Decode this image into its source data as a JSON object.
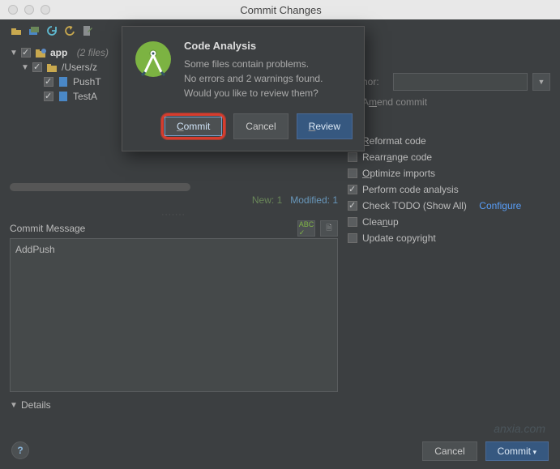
{
  "window": {
    "title": "Commit Changes"
  },
  "tree": {
    "root": {
      "name": "app",
      "suffix": "(2 files)"
    },
    "folder": {
      "path": "/Users/z"
    },
    "files": [
      "PushT",
      "TestA"
    ]
  },
  "stats": {
    "new_label": "New:",
    "new_count": "1",
    "mod_label": "Modified:",
    "mod_count": "1"
  },
  "commit_msg": {
    "label": "Commit Message",
    "value": "AddPush"
  },
  "details": {
    "label": "Details"
  },
  "right": {
    "author_label": "Author:",
    "amend_label": "Amend commit",
    "reformat": "Reformat code",
    "rearrange": "Rearrange code",
    "optimize": "Optimize imports",
    "analysis": "Perform code analysis",
    "todo": "Check TODO (Show All)",
    "configure": "Configure",
    "cleanup": "Cleanup",
    "copyright": "Update copyright"
  },
  "buttons": {
    "cancel": "Cancel",
    "commit": "Commit",
    "help": "?"
  },
  "modal": {
    "title": "Code Analysis",
    "line1": "Some files contain problems.",
    "line2": "No errors and 2 warnings found.",
    "line3": "Would you like to review them?",
    "commit": "Commit",
    "cancel": "Cancel",
    "review": "Review"
  },
  "watermark": "anxia.com"
}
